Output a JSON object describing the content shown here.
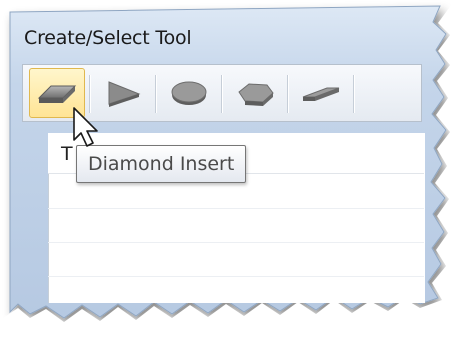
{
  "window": {
    "title": "Create/Select Tool"
  },
  "toolbar": {
    "buttons": [
      {
        "icon": "diamond-insert-icon",
        "active": true
      },
      {
        "icon": "triangle-insert-icon",
        "active": false
      },
      {
        "icon": "round-insert-icon",
        "active": false
      },
      {
        "icon": "pentagon-insert-icon",
        "active": false
      },
      {
        "icon": "rhombus-insert-icon",
        "active": false
      }
    ]
  },
  "list": {
    "column_header_partial": "T"
  },
  "tooltip": {
    "text": "Diamond Insert"
  },
  "colors": {
    "window_frame": "#b9cde6",
    "active_button": "#ffe495",
    "insert_fill": "#8a8a8a"
  }
}
